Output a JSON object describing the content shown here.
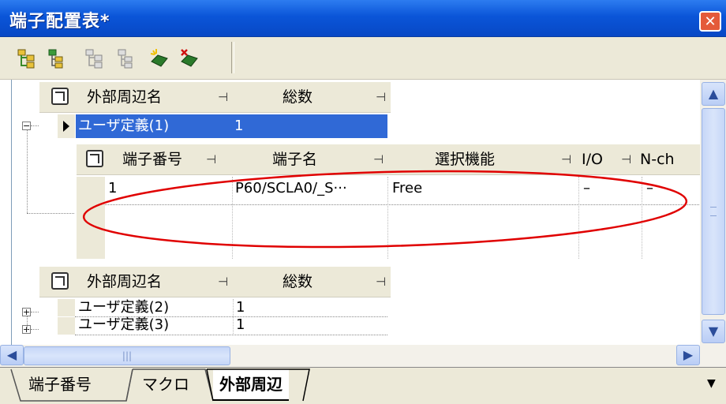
{
  "window": {
    "title": "端子配置表*",
    "close_glyph": "✕"
  },
  "toolbar": {
    "buttons": [
      "expand-all-icon",
      "expand-icon",
      "collapse-all-icon",
      "collapse-icon",
      "add-icon",
      "delete-icon"
    ]
  },
  "outer_table": {
    "headers": {
      "name": "外部周辺名",
      "count": "総数"
    },
    "rows": [
      {
        "name": "ユーザ定義(1)",
        "count": "1",
        "expanded": true,
        "selected": true
      },
      {
        "name": "ユーザ定義(2)",
        "count": "1",
        "expanded": false,
        "selected": false
      },
      {
        "name": "ユーザ定義(3)",
        "count": "1",
        "expanded": false,
        "selected": false
      }
    ]
  },
  "inner_table": {
    "headers": {
      "pin_no": "端子番号",
      "pin_name": "端子名",
      "function": "選択機能",
      "io": "I/O",
      "nch": "N-ch"
    },
    "rows": [
      {
        "pin_no": "1",
        "pin_name": "P60/SCLA0/_S···",
        "function": "Free",
        "io": "–",
        "nch": "–"
      }
    ]
  },
  "tabs": [
    "端子番号",
    "マクロ",
    "外部周辺"
  ],
  "active_tab": "外部周辺",
  "colors": {
    "titlebar": "#0a55d8",
    "selection": "#3069d6",
    "annotation": "#e00000"
  }
}
